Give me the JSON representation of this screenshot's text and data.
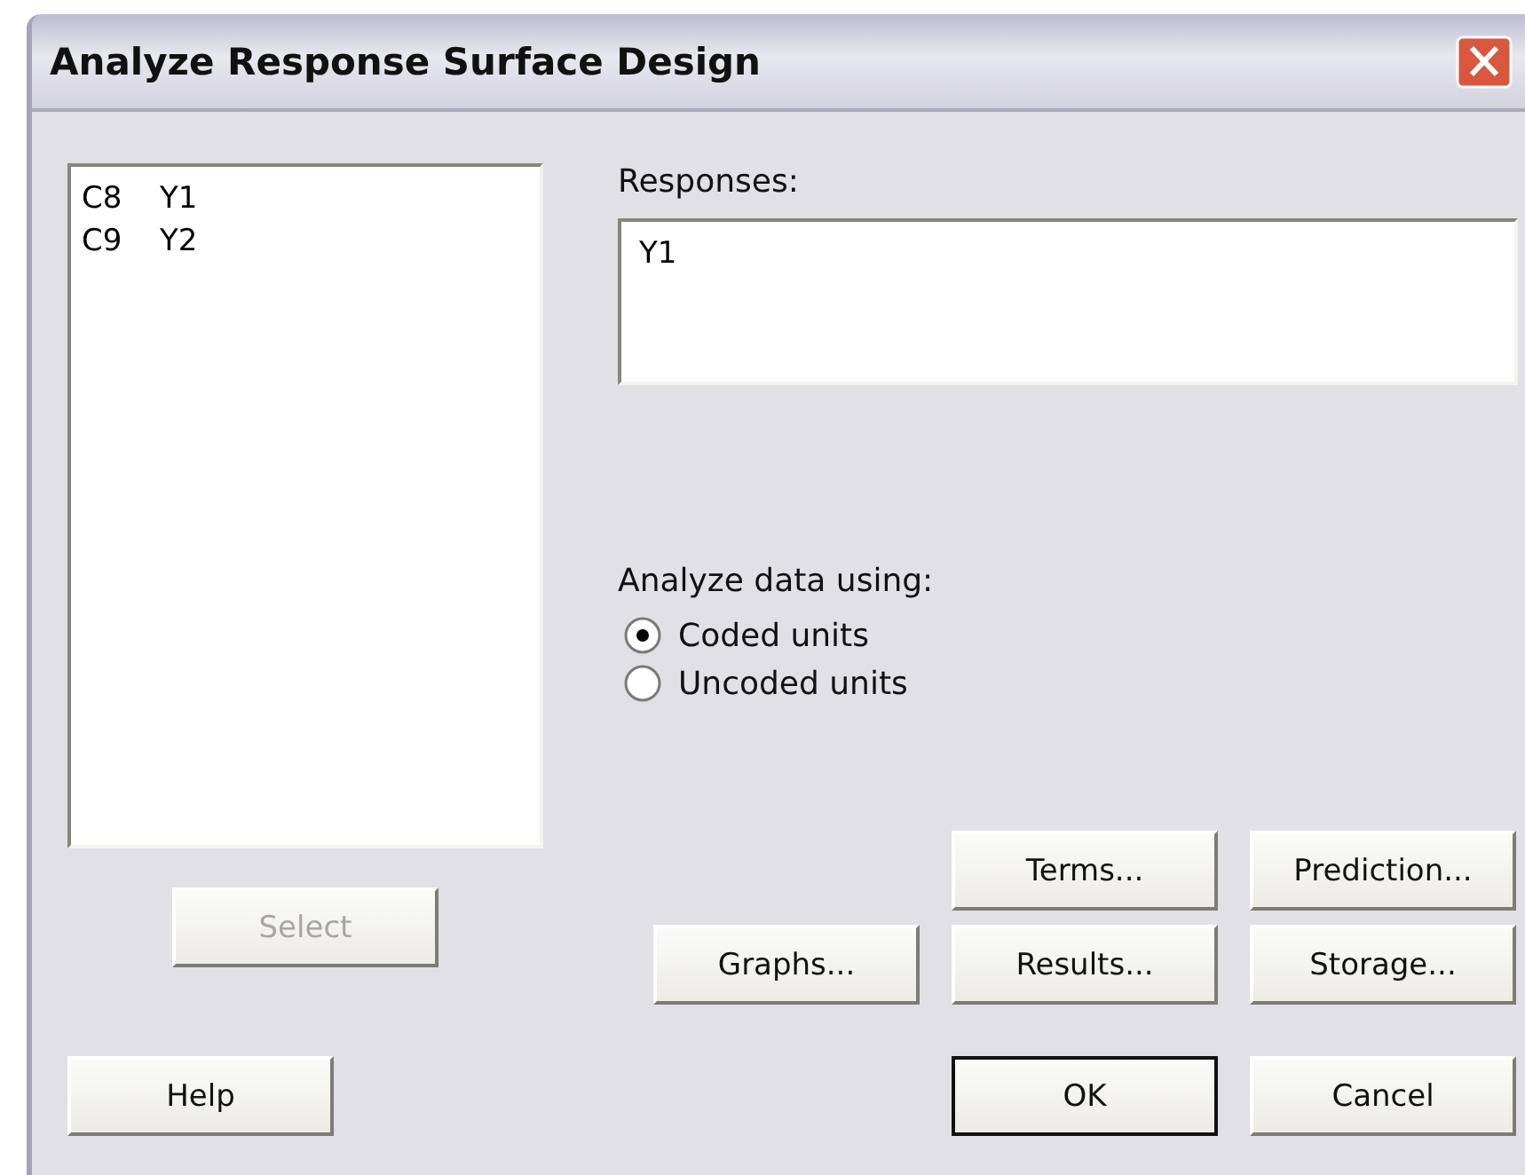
{
  "window": {
    "title": "Analyze Response Surface Design"
  },
  "columns_list": {
    "items": [
      {
        "column": "C8",
        "name": "Y1",
        "selected": false
      },
      {
        "column": "C9",
        "name": "Y2",
        "selected": false
      }
    ]
  },
  "select_button": {
    "label": "Select",
    "disabled": true
  },
  "responses": {
    "label": "Responses:",
    "value": "Y1"
  },
  "analyze_using": {
    "label": "Analyze data using:",
    "options": [
      {
        "label": "Coded units",
        "selected": true
      },
      {
        "label": "Uncoded units",
        "selected": false
      }
    ]
  },
  "option_buttons": [
    {
      "label": "Terms...",
      "disabled": false
    },
    {
      "label": "Prediction...",
      "disabled": false
    },
    {
      "label": "Graphs...",
      "disabled": false
    },
    {
      "label": "Results...",
      "disabled": false
    },
    {
      "label": "Storage...",
      "disabled": false
    }
  ],
  "dialog_buttons": [
    {
      "label": "Help",
      "default": false,
      "disabled": false
    },
    {
      "label": "OK",
      "default": true,
      "disabled": false
    },
    {
      "label": "Cancel",
      "default": false,
      "disabled": false
    }
  ]
}
